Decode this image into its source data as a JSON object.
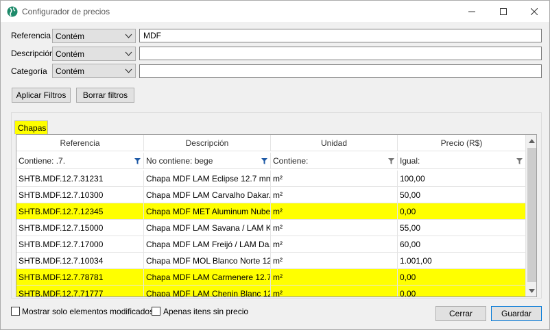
{
  "window": {
    "title": "Configurador de precios"
  },
  "filters": [
    {
      "label": "Referencia",
      "operator": "Contém",
      "value": "MDF"
    },
    {
      "label": "Descripción",
      "operator": "Contém",
      "value": ""
    },
    {
      "label": "Categoría",
      "operator": "Contém",
      "value": ""
    }
  ],
  "buttons": {
    "apply": "Aplicar Filtros",
    "clear": "Borrar filtros",
    "close": "Cerrar",
    "save": "Guardar"
  },
  "tab": {
    "label": "Chapas"
  },
  "grid": {
    "columns": [
      "Referencia",
      "Descripción",
      "Unidad",
      "Precio (R$)"
    ],
    "column_filters": [
      "Contiene:  .7.",
      "No contiene:  bege",
      "Contiene:",
      "Igual:"
    ],
    "rows": [
      {
        "ref": "SHTB.MDF.12.7.31231",
        "desc": "Chapa MDF LAM Eclipse 12.7 mm",
        "unit": "m²",
        "price": "100,00",
        "highlight": false
      },
      {
        "ref": "SHTB.MDF.12.7.10300",
        "desc": "Chapa MDF LAM Carvalho Dakar...",
        "unit": "m²",
        "price": "50,00",
        "highlight": false
      },
      {
        "ref": "SHTB.MDF.12.7.12345",
        "desc": "Chapa MDF MET Aluminum Nube...",
        "unit": "m²",
        "price": "0,00",
        "highlight": true
      },
      {
        "ref": "SHTB.MDF.12.7.15000",
        "desc": "Chapa MDF LAM Savana / LAM K...",
        "unit": "m²",
        "price": "55,00",
        "highlight": false
      },
      {
        "ref": "SHTB.MDF.12.7.17000",
        "desc": "Chapa MDF LAM Freijó / LAM Da...",
        "unit": "m²",
        "price": "60,00",
        "highlight": false
      },
      {
        "ref": "SHTB.MDF.12.7.10034",
        "desc": "Chapa MDF MOL Blanco Norte 12...",
        "unit": "m²",
        "price": "1.001,00",
        "highlight": false
      },
      {
        "ref": "SHTB.MDF.12.7.78781",
        "desc": "Chapa MDF LAM Carmenere 12.7...",
        "unit": "m²",
        "price": "0,00",
        "highlight": true
      },
      {
        "ref": "SHTB.MDF.12.7.71777",
        "desc": "Chapa MDF LAM Chenin Blanc 12...",
        "unit": "m²",
        "price": "0,00",
        "highlight": true
      }
    ]
  },
  "checkboxes": [
    {
      "label": "Mostrar solo elementos modificados",
      "checked": false
    },
    {
      "label": "Apenas itens sin precio",
      "checked": false
    }
  ],
  "colors": {
    "highlight": "#ffff00",
    "accent": "#0078d7"
  }
}
